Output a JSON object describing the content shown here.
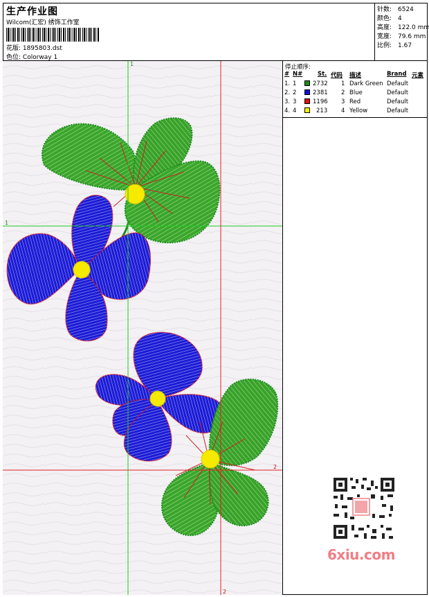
{
  "header": {
    "title": "生产作业图",
    "company": "Wilcom(汇宏) 绣饰工作室",
    "design_label": "花版:",
    "design_file": "1895803.dst",
    "colorway_label": "色位:",
    "colorway": "Colorway 1"
  },
  "stats": [
    {
      "label": "针数:",
      "value": "6524"
    },
    {
      "label": "颜色:",
      "value": "4"
    },
    {
      "label": "高度:",
      "value": "122.0 mm"
    },
    {
      "label": "宽度:",
      "value": "79.6 mm"
    },
    {
      "label": "比例:",
      "value": "1.67"
    }
  ],
  "color_table": {
    "stop_sequence_label": "停止顺序:",
    "headers": [
      "#",
      "N#",
      "St.",
      "代码",
      "描述",
      "Brand",
      "元素"
    ],
    "rows": [
      {
        "num": "1.",
        "n": "1",
        "stitches": "2732",
        "code": "1",
        "desc": "Dark Green",
        "brand": "Default",
        "color": "#1a8c1a"
      },
      {
        "num": "2.",
        "n": "2",
        "stitches": "2381",
        "code": "2",
        "desc": "Blue",
        "brand": "Default",
        "color": "#1010e0"
      },
      {
        "num": "3.",
        "n": "3",
        "stitches": "1196",
        "code": "3",
        "desc": "Red",
        "brand": "Default",
        "color": "#e01010"
      },
      {
        "num": "4.",
        "n": "4",
        "stitches": "213",
        "code": "4",
        "desc": "Yellow",
        "brand": "Default",
        "color": "#f5f000"
      }
    ]
  },
  "guides": {
    "green_v": "1",
    "green_h": "1",
    "red_v": "2",
    "red_h": "2"
  },
  "watermark": "6xiu.com",
  "colors": {
    "green": "#2e9a22",
    "blue": "#1818d8",
    "red": "#e01818",
    "yellow": "#f8f000",
    "guide_green": "#22c822",
    "guide_red": "#e02020"
  }
}
